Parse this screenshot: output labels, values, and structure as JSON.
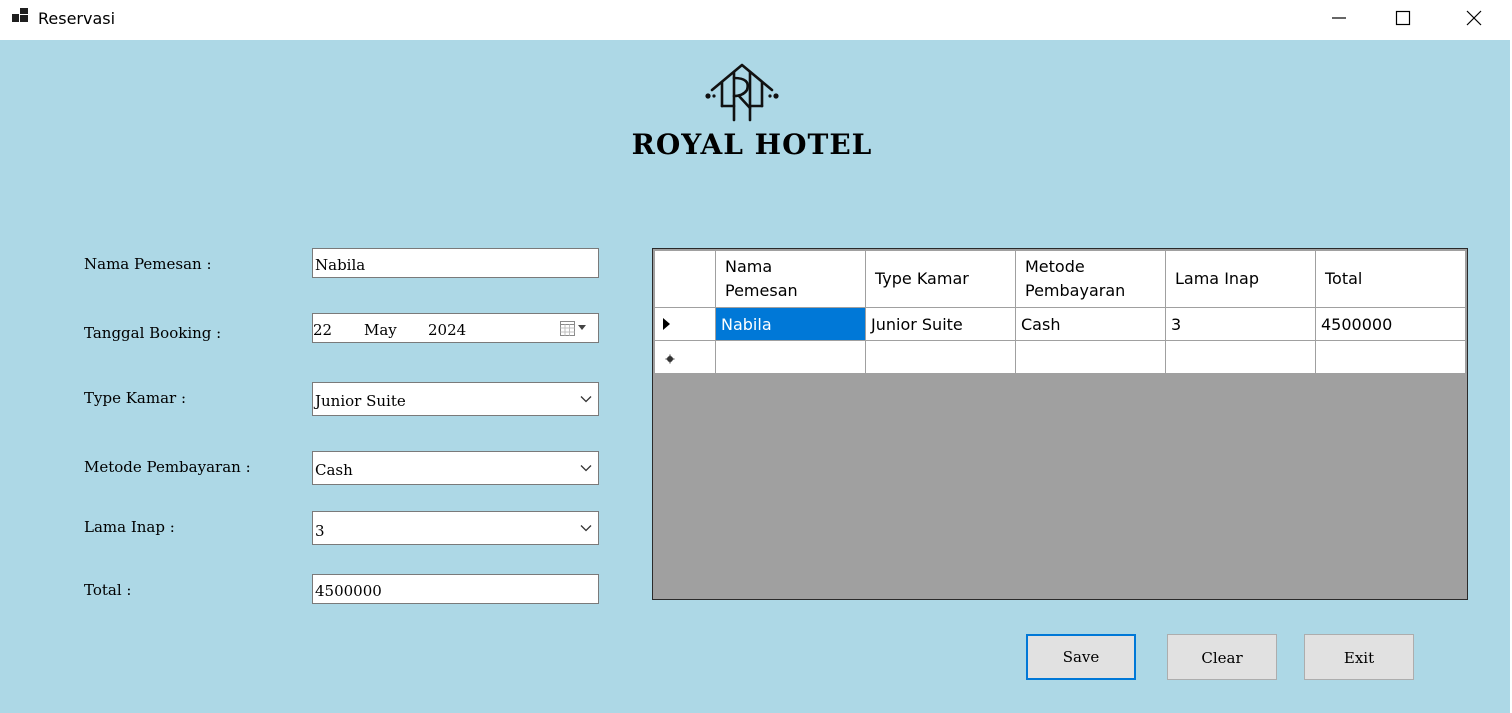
{
  "window": {
    "title": "Reservasi"
  },
  "brand": {
    "name": "ROYAL HOTEL"
  },
  "form": {
    "nama_pemesan": {
      "label": "Nama Pemesan :",
      "value": "Nabila"
    },
    "tanggal_booking": {
      "label": "Tanggal Booking :",
      "day": "22",
      "month": "May",
      "year": "2024"
    },
    "type_kamar": {
      "label": "Type Kamar :",
      "value": "Junior Suite"
    },
    "metode_pembayaran": {
      "label": "Metode Pembayaran :",
      "value": "Cash"
    },
    "lama_inap": {
      "label": "Lama Inap :",
      "value": "3"
    },
    "total": {
      "label": "Total :",
      "value": "4500000"
    }
  },
  "grid": {
    "headers": {
      "nama_line1": "Nama",
      "nama_line2": "Pemesan",
      "type": "Type Kamar",
      "metode_line1": "Metode",
      "metode_line2": "Pembayaran",
      "lama": "Lama Inap",
      "total": "Total"
    },
    "rows": [
      {
        "nama": "Nabila",
        "type": "Junior Suite",
        "metode": "Cash",
        "lama": "3",
        "total": "4500000"
      }
    ]
  },
  "buttons": {
    "save": "Save",
    "clear": "Clear",
    "exit": "Exit"
  }
}
